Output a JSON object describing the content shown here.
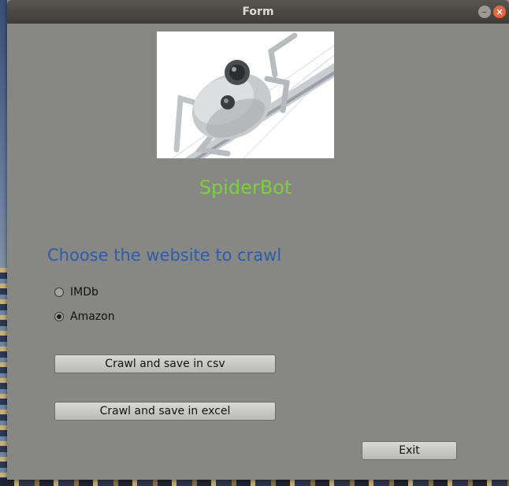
{
  "window": {
    "title": "Form"
  },
  "titlebar": {
    "minimize_symbol": "–",
    "close_symbol": "×"
  },
  "logo": {
    "icon": "spider-robot-image"
  },
  "app": {
    "name": "SpiderBot"
  },
  "form": {
    "heading": "Choose the website to crawl",
    "options": [
      {
        "label": "IMDb",
        "selected": false
      },
      {
        "label": "Amazon",
        "selected": true
      }
    ],
    "buttons": {
      "csv": "Crawl and save in csv",
      "excel": "Crawl and save in excel",
      "exit": "Exit"
    }
  },
  "colors": {
    "window_bg": "#878884",
    "app_name": "#7ad13b",
    "heading": "#2f5ca8",
    "close_button": "#e9643b"
  }
}
